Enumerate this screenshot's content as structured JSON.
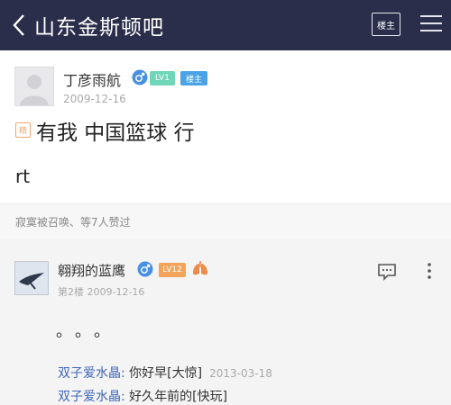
{
  "header": {
    "title": "山东金斯顿吧",
    "louzhu_button": "楼主"
  },
  "post": {
    "username": "丁彦雨航",
    "level": "LV1",
    "louzhu_badge": "楼主",
    "date": "2009-12-16",
    "jing_label": "精",
    "title": "有我 中国篮球 行",
    "body": "rt",
    "likes_text": "寂寞被召唤、等7人赞过"
  },
  "reply": {
    "username": "翱翔的蓝鹰",
    "level": "LV12",
    "floor_date": "第2楼  2009-12-16",
    "dots": "。。。",
    "sub_reply": {
      "name": "双子爱水晶:",
      "text": " 你好早[大惊]",
      "date": "2013-03-18"
    },
    "sub_reply_2": {
      "name": "双子爱水晶:",
      "text": " 好久年前的[快玩]"
    }
  },
  "colors": {
    "header_bg": "#2b2e4a",
    "link_blue": "#3d66b8",
    "lv1_green": "#6fd6b8",
    "lz_blue": "#4aa3e6",
    "lv12_orange": "#f2a45a"
  }
}
